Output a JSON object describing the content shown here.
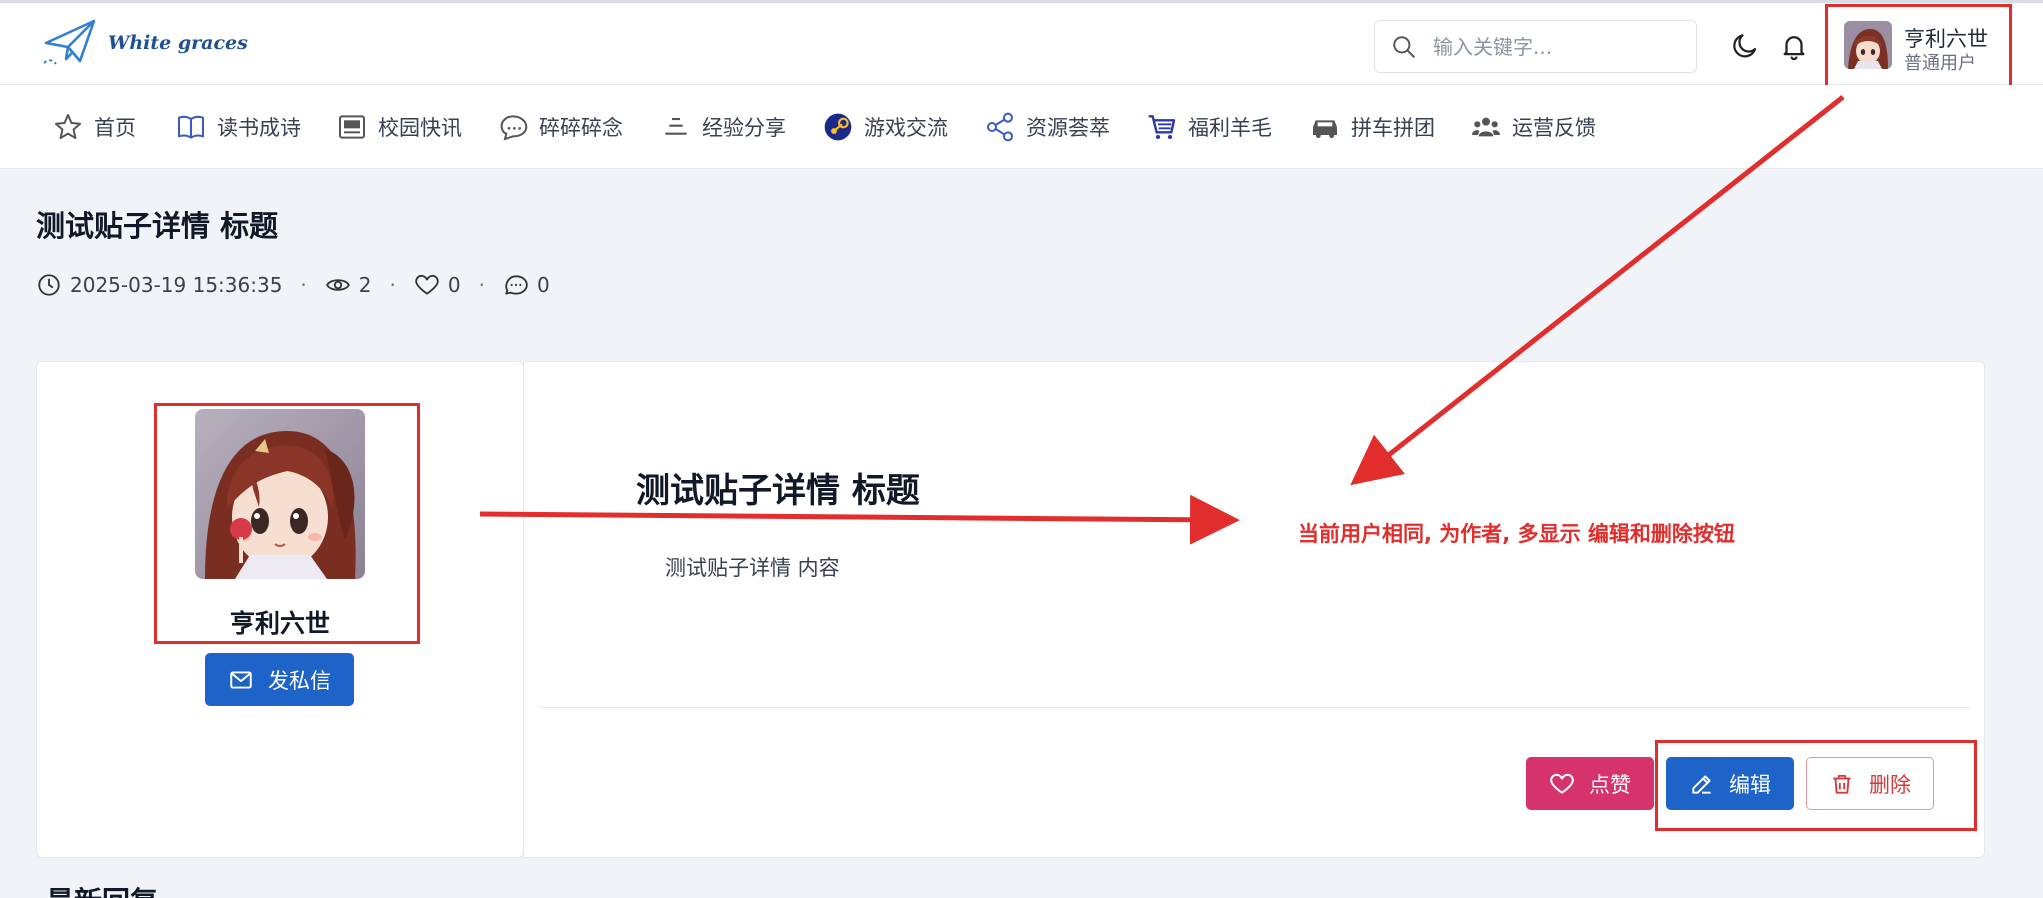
{
  "header": {
    "logo_text": "White graces",
    "search_placeholder": "输入关键字...",
    "user": {
      "name": "亨利六世",
      "role": "普通用户"
    }
  },
  "nav": {
    "items": [
      {
        "label": "首页",
        "icon": "star-icon"
      },
      {
        "label": "读书成诗",
        "icon": "book-icon"
      },
      {
        "label": "校园快讯",
        "icon": "newspaper-icon"
      },
      {
        "label": "碎碎碎念",
        "icon": "chat-bubble-icon"
      },
      {
        "label": "经验分享",
        "icon": "layers-icon"
      },
      {
        "label": "游戏交流",
        "icon": "steam-icon"
      },
      {
        "label": "资源荟萃",
        "icon": "share-icon"
      },
      {
        "label": "福利羊毛",
        "icon": "cart-icon"
      },
      {
        "label": "拼车拼团",
        "icon": "car-icon"
      },
      {
        "label": "运营反馈",
        "icon": "users-icon"
      }
    ]
  },
  "post": {
    "title": "测试贴子详情 标题",
    "date": "2025-03-19 15:36:35",
    "views": "2",
    "likes": "0",
    "comments": "0",
    "content_title": "测试贴子详情 标题",
    "content_body": "测试贴子详情 内容"
  },
  "author": {
    "name": "亨利六世",
    "message_button": "发私信"
  },
  "actions": {
    "like": "点赞",
    "edit": "编辑",
    "delete": "删除"
  },
  "annotation": "当前用户相同, 为作者, 多显示 编辑和删除按钮",
  "next_section": "最新回复",
  "colors": {
    "primary": "#1e64c8",
    "like": "#d6336c",
    "danger": "#d63939",
    "annotation_red": "#e22d2d"
  }
}
